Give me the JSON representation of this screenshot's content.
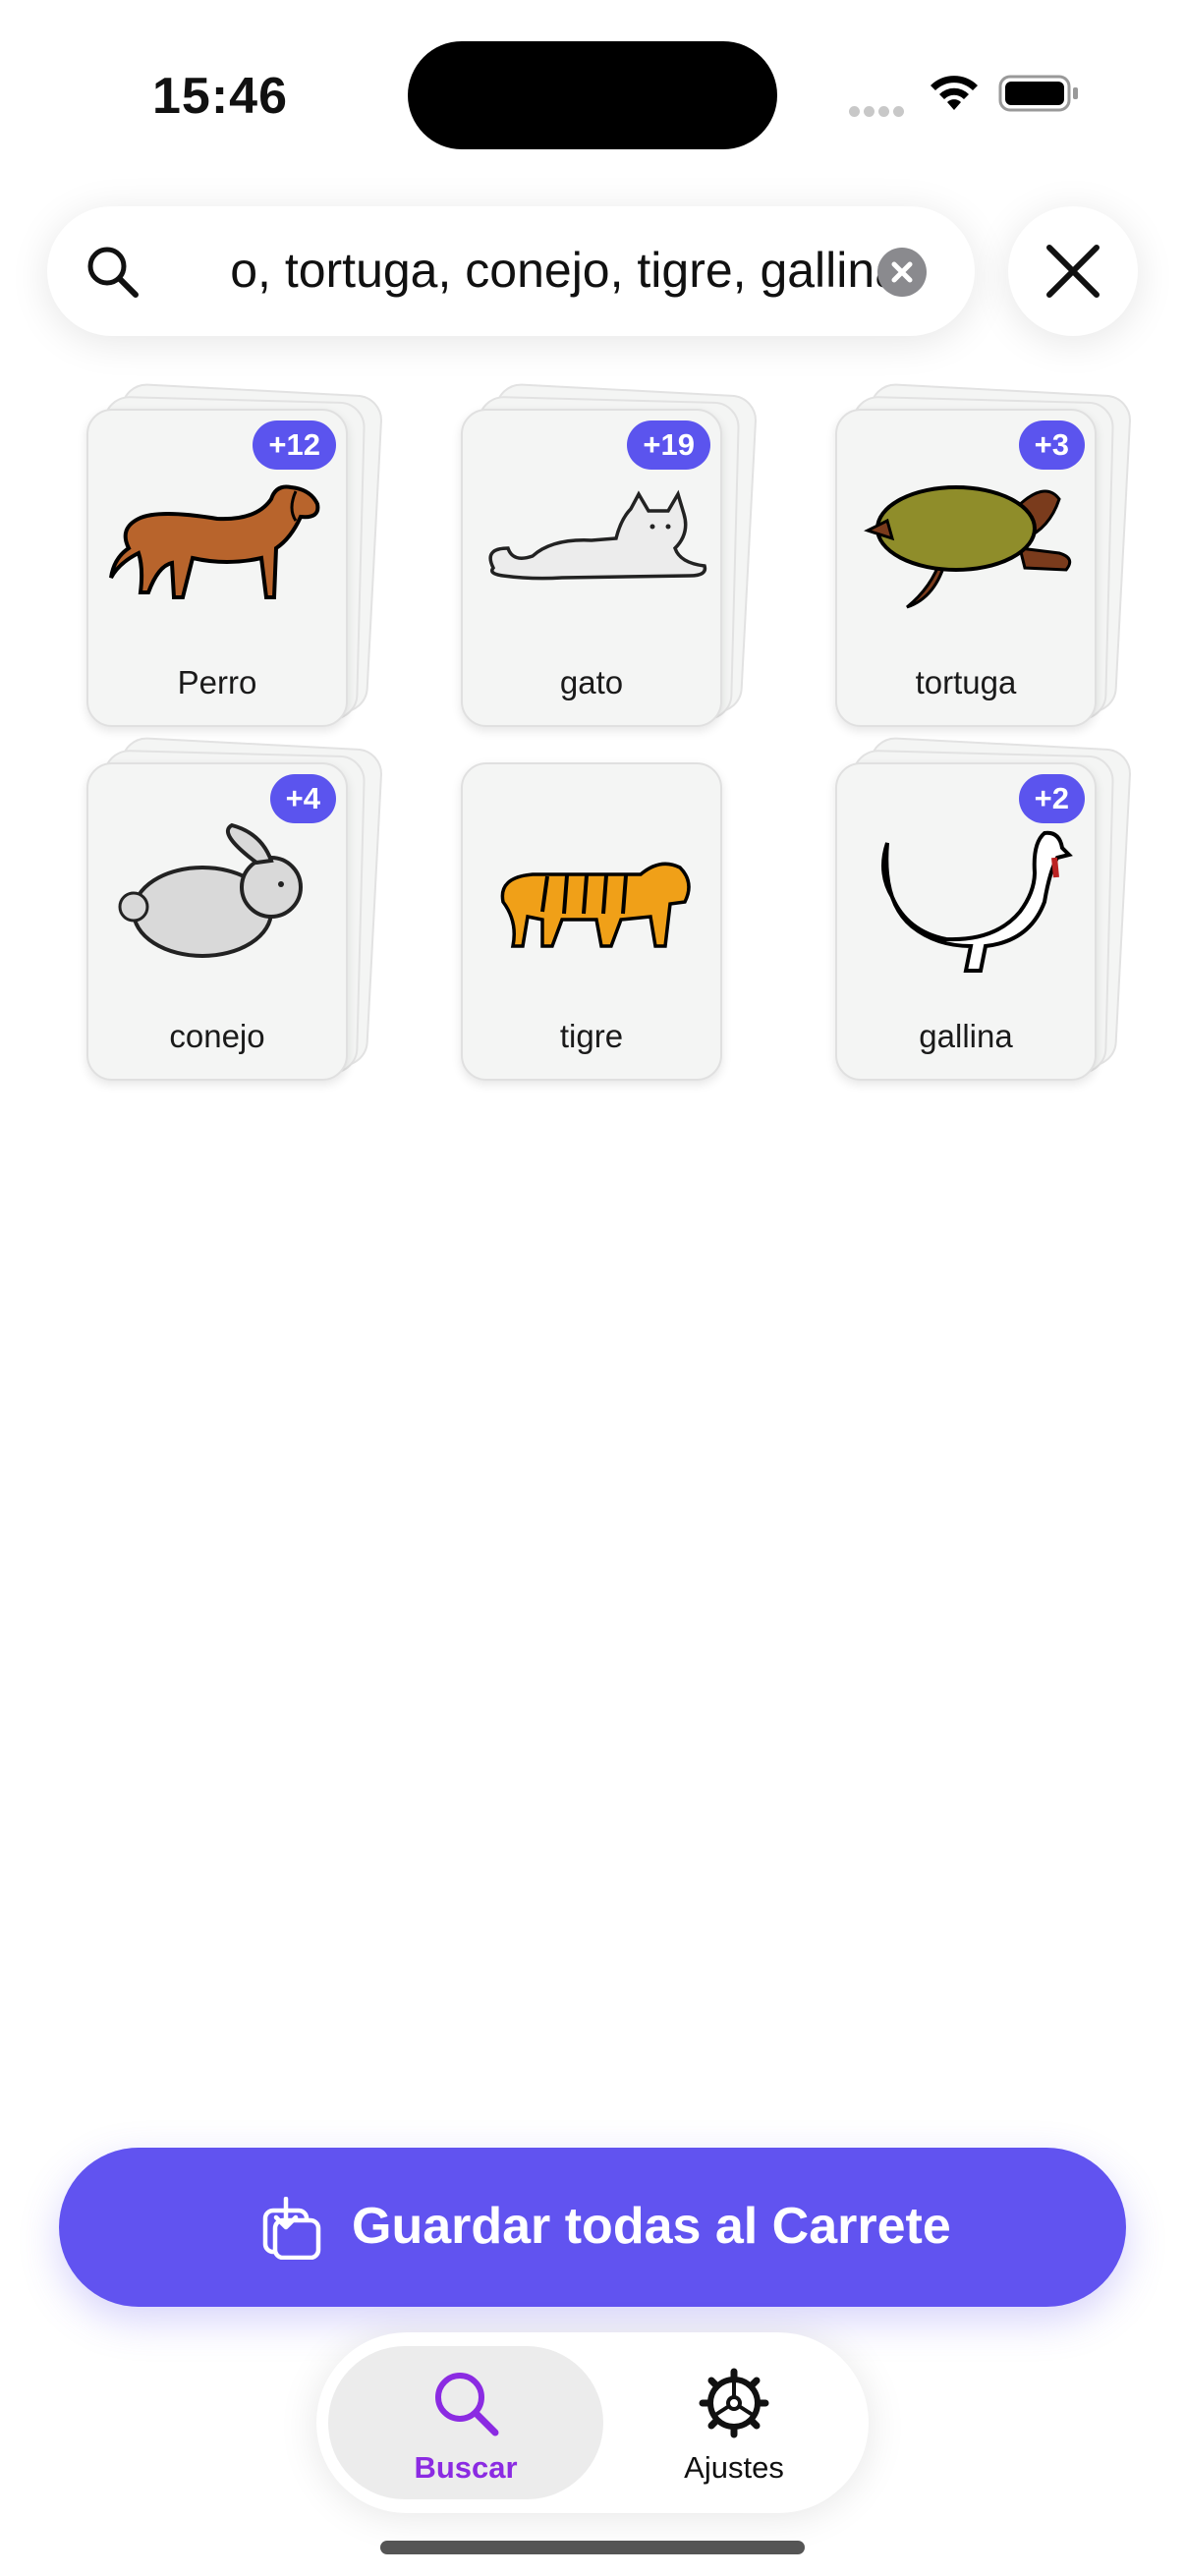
{
  "status_bar": {
    "time": "15:46"
  },
  "search": {
    "value": "perro, gato, tortuga, conejo, tigre, gallina",
    "visible_text": "o, tortuga, conejo, tigre, gallina"
  },
  "results": [
    {
      "label": "Perro",
      "badge": "+12",
      "image": "dog-icon"
    },
    {
      "label": "gato",
      "badge": "+19",
      "image": "cat-icon"
    },
    {
      "label": "tortuga",
      "badge": "+3",
      "image": "turtle-icon"
    },
    {
      "label": "conejo",
      "badge": "+4",
      "image": "rabbit-icon"
    },
    {
      "label": "tigre",
      "badge": "",
      "image": "tiger-icon"
    },
    {
      "label": "gallina",
      "badge": "+2",
      "image": "hen-icon"
    }
  ],
  "save_button": {
    "label": "Guardar todas al Carrete"
  },
  "tabbar": {
    "tabs": [
      {
        "label": "Buscar",
        "icon": "search-icon",
        "active": true
      },
      {
        "label": "Ajustes",
        "icon": "gear-icon",
        "active": false
      }
    ]
  },
  "colors": {
    "accent": "#6153f0",
    "tab_active": "#8b2be2",
    "badge": "#5b54ee"
  }
}
